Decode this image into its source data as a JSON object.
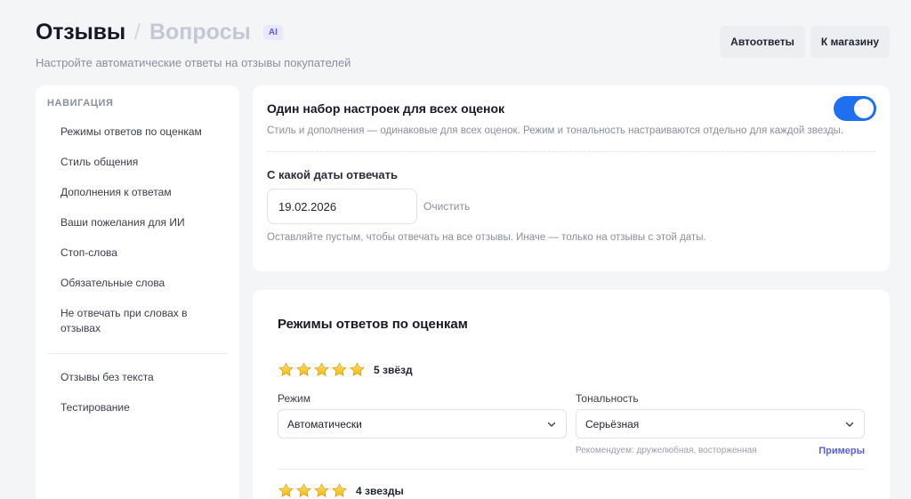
{
  "header": {
    "title": "Отзывы",
    "separator": "/",
    "title_secondary": "Вопросы",
    "ai_badge": "AI",
    "subtitle": "Настройте автоматические ответы на отзывы покупателей"
  },
  "top_actions": {
    "autoreplies": "Автоответы",
    "to_store": "К магазину"
  },
  "sidebar": {
    "title": "НАВИГАЦИЯ",
    "items": [
      {
        "label": "Режимы ответов по оценкам"
      },
      {
        "label": "Стиль общения"
      },
      {
        "label": "Дополнения к ответам"
      },
      {
        "label": "Ваши пожелания для ИИ"
      },
      {
        "label": "Стоп-слова"
      },
      {
        "label": "Обязательные слова"
      },
      {
        "label": "Не отвечать при словах в отзывах"
      }
    ],
    "items_bottom": [
      {
        "label": "Отзывы без текста"
      },
      {
        "label": "Тестирование"
      }
    ]
  },
  "settings": {
    "single_set_title": "Один набор настроек для всех оценок",
    "single_set_enabled": true,
    "single_set_desc": "Стиль и дополнения — одинаковые для всех оценок. Режим и тональность настраиваются отдельно для каждой звезды.",
    "date_label": "С какой даты отвечать",
    "date_value": "19.02.2026",
    "clear": "Очистить",
    "date_hint": "Оставляйте пустым, чтобы отвечать на все отзывы. Иначе — только на отзывы с этой даты."
  },
  "modes": {
    "title": "Режимы ответов по оценкам",
    "ratings": [
      {
        "stars": 5,
        "label": "5 звёзд",
        "mode_label": "Режим",
        "mode_value": "Автоматически",
        "tone_label": "Тональность",
        "tone_value": "Серьёзная",
        "recommend": "Рекомендуем: дружелюбная, восторженная",
        "examples": "Примеры"
      },
      {
        "stars": 4,
        "label": "4 звезды"
      }
    ]
  },
  "colors": {
    "accent": "#1f6ff0",
    "star": "#f5c518",
    "link": "#5a5fe0"
  }
}
